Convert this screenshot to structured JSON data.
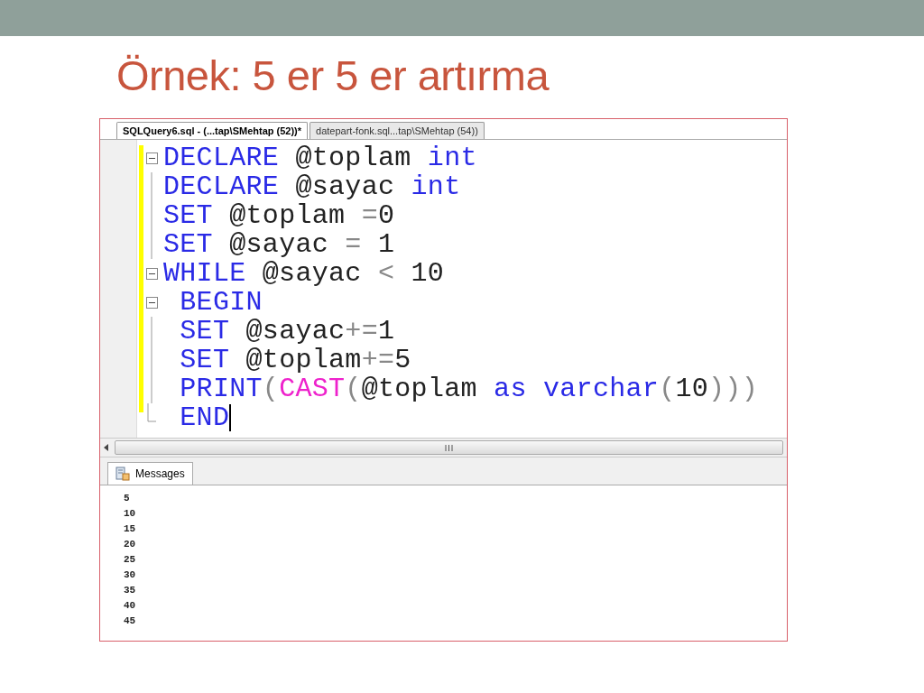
{
  "slide_title": "Örnek: 5 er 5 er artırma",
  "editor_tabs": [
    {
      "label": "SQLQuery6.sql - (...tap\\SMehtap (52))*",
      "selected": true
    },
    {
      "label": "datepart-fonk.sql...tap\\SMehtap (54))",
      "selected": false
    }
  ],
  "code_lines": [
    {
      "kind": "fold_start",
      "tokens": [
        {
          "kind": "keyword",
          "text": "DECLARE"
        },
        {
          "kind": "plain",
          "text": " @toplam "
        },
        {
          "kind": "keyword",
          "text": "int"
        }
      ]
    },
    {
      "kind": "fold_body",
      "tokens": [
        {
          "kind": "keyword",
          "text": "DECLARE"
        },
        {
          "kind": "plain",
          "text": " @sayac "
        },
        {
          "kind": "keyword",
          "text": "int"
        }
      ]
    },
    {
      "kind": "fold_body",
      "tokens": [
        {
          "kind": "keyword",
          "text": "SET"
        },
        {
          "kind": "plain",
          "text": " @toplam "
        },
        {
          "kind": "operator",
          "text": "="
        },
        {
          "kind": "plain",
          "text": "0"
        }
      ]
    },
    {
      "kind": "fold_body",
      "tokens": [
        {
          "kind": "keyword",
          "text": "SET"
        },
        {
          "kind": "plain",
          "text": " @sayac "
        },
        {
          "kind": "operator",
          "text": "="
        },
        {
          "kind": "plain",
          "text": " 1"
        }
      ]
    },
    {
      "kind": "fold_start",
      "tokens": [
        {
          "kind": "keyword",
          "text": "WHILE"
        },
        {
          "kind": "plain",
          "text": " @sayac "
        },
        {
          "kind": "operator",
          "text": "<"
        },
        {
          "kind": "plain",
          "text": " 10"
        }
      ]
    },
    {
      "kind": "fold_start",
      "tokens": [
        {
          "kind": "keyword",
          "text": " BEGIN"
        }
      ]
    },
    {
      "kind": "fold_body",
      "tokens": [
        {
          "kind": "keyword",
          "text": " SET"
        },
        {
          "kind": "plain",
          "text": " @sayac"
        },
        {
          "kind": "operator",
          "text": "+="
        },
        {
          "kind": "plain",
          "text": "1"
        }
      ]
    },
    {
      "kind": "fold_body",
      "tokens": [
        {
          "kind": "keyword",
          "text": " SET"
        },
        {
          "kind": "plain",
          "text": " @toplam"
        },
        {
          "kind": "operator",
          "text": "+="
        },
        {
          "kind": "plain",
          "text": "5"
        }
      ]
    },
    {
      "kind": "fold_body",
      "tokens": [
        {
          "kind": "keyword",
          "text": " PRINT"
        },
        {
          "kind": "operator",
          "text": "("
        },
        {
          "kind": "function",
          "text": "CAST"
        },
        {
          "kind": "operator",
          "text": "("
        },
        {
          "kind": "plain",
          "text": "@toplam "
        },
        {
          "kind": "keyword",
          "text": "as varchar"
        },
        {
          "kind": "operator",
          "text": "("
        },
        {
          "kind": "plain",
          "text": "10"
        },
        {
          "kind": "operator",
          "text": ")))"
        }
      ]
    },
    {
      "kind": "fold_end",
      "cursor": true,
      "tokens": [
        {
          "kind": "keyword",
          "text": " END"
        }
      ]
    }
  ],
  "results_tab": {
    "label": "Messages",
    "selected": true
  },
  "messages": [
    "5",
    "10",
    "15",
    "20",
    "25",
    "30",
    "35",
    "40",
    "45"
  ]
}
